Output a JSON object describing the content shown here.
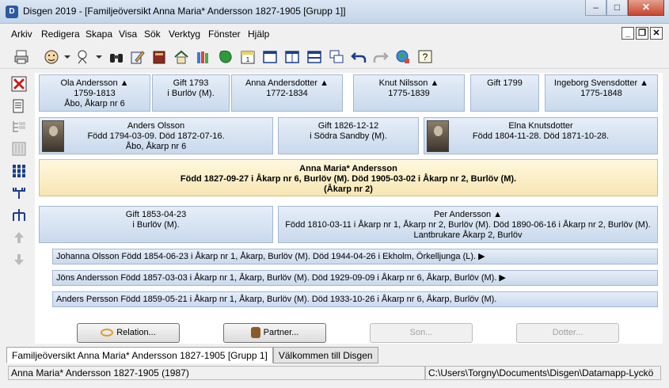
{
  "window": {
    "title": "Disgen 2019 - [Familjeöversikt Anna Maria* Andersson 1827-1905 [Grupp 1]]",
    "minimize": "–",
    "maximize": "□",
    "close": "✕"
  },
  "menu": [
    "Arkiv",
    "Redigera",
    "Skapa",
    "Visa",
    "Sök",
    "Verktyg",
    "Fönster",
    "Hjälp"
  ],
  "mdi": {
    "minimize": "_",
    "restore": "❐",
    "close": "✕"
  },
  "grandparents": [
    {
      "lines": [
        "Ola Andersson ▲",
        "1759-1813",
        "Åbo, Åkarp nr 6"
      ]
    },
    {
      "lines": [
        "Gift 1793",
        "i Burlöv (M)."
      ]
    },
    {
      "lines": [
        "Anna Andersdotter ▲",
        "1772-1834"
      ]
    },
    {
      "lines": [
        "Knut Nilsson ▲",
        "1775-1839"
      ]
    },
    {
      "lines": [
        "Gift 1799"
      ]
    },
    {
      "lines": [
        "Ingeborg Svensdotter ▲",
        "1775-1848"
      ]
    }
  ],
  "parents": {
    "father": [
      "Anders Olsson",
      "Född 1794-03-09. Död 1872-07-16.",
      "Åbo, Åkarp nr 6"
    ],
    "marriage": [
      "Gift 1826-12-12",
      "i Södra Sandby (M)."
    ],
    "mother": [
      "Elna Knutsdotter",
      "Född 1804-11-28. Död 1871-10-28."
    ]
  },
  "main_person": {
    "lines": [
      "Anna Maria* Andersson",
      "Född 1827-09-27 i Åkarp nr 6, Burlöv (M). Död 1905-03-02 i Åkarp nr 2, Burlöv (M).",
      "(Åkarp nr 2)"
    ]
  },
  "spouse": {
    "marriage": [
      "Gift 1853-04-23",
      "i Burlöv (M)."
    ],
    "partner": [
      "Per Andersson ▲",
      "Född 1810-03-11 i Åkarp nr 1, Åkarp nr 2, Burlöv (M). Död 1890-06-16 i Åkarp nr 2, Burlöv (M).",
      "Lantbrukare Åkarp 2, Burlöv"
    ]
  },
  "children": [
    "Johanna Olsson Född 1854-06-23 i Åkarp nr 1, Åkarp, Burlöv (M). Död 1944-04-26 i Ekholm, Örkelljunga (L). ▶",
    "Jöns Andersson Född 1857-03-03 i Åkarp nr 1, Åkarp, Burlöv (M). Död 1929-09-09 i Åkarp nr 6, Åkarp, Burlöv (M). ▶",
    "Anders Persson Född 1859-05-21 i Åkarp nr 1, Åkarp, Burlöv (M). Död 1933-10-26 i Åkarp nr 6, Åkarp, Burlöv (M)."
  ],
  "buttons": {
    "relation": "Relation...",
    "partner": "Partner...",
    "son": "Son...",
    "dotter": "Dotter..."
  },
  "tabs": [
    "Familjeöversikt Anna Maria* Andersson 1827-1905 [Grupp 1]",
    "Välkommen till Disgen"
  ],
  "status": {
    "person": "Anna Maria* Andersson 1827-1905 (1987)",
    "path": "C:\\Users\\Torgny\\Documents\\Disgen\\Datamapp-Lyckö"
  },
  "colors": {
    "card": "#c9d9ec",
    "main_card": "#f7e6b3",
    "accent": "#2c5aa0"
  }
}
